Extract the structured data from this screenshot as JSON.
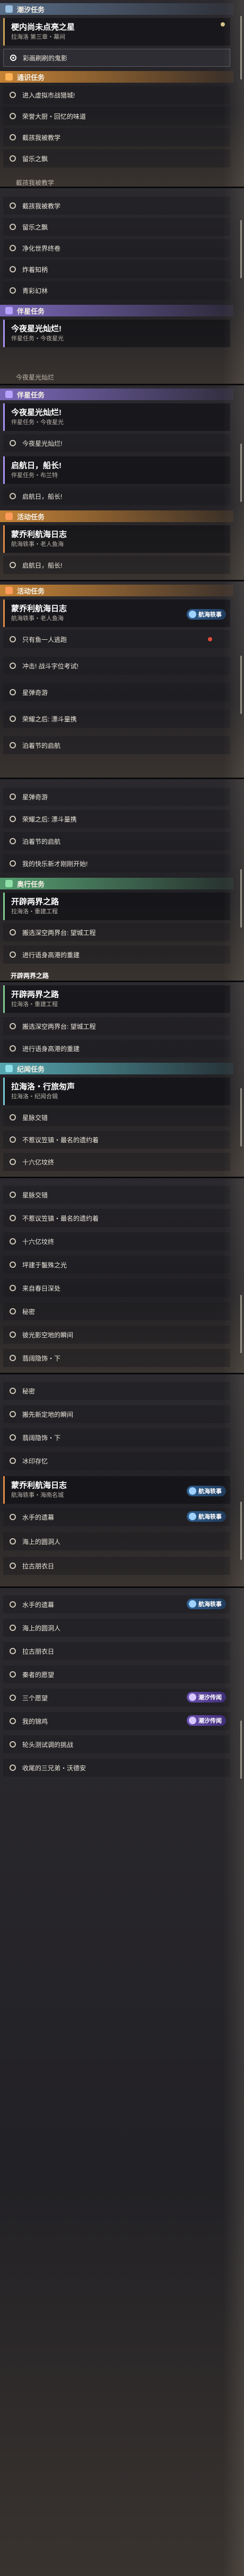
{
  "colors": {
    "tide": "#9cc0e0",
    "path": "#ffb357",
    "companion": "#b7a3ff",
    "event": "#ff9b5a",
    "trail": "#8fe0a8",
    "memorial": "#8fe0e8"
  },
  "badges": {
    "voyage": "航海轶事",
    "tide": "潮汐传闻"
  },
  "panels": [
    {
      "header_tide": "潮汐任务",
      "card_title": "梗内尚未点亮之星",
      "card_sub": "拉海洛 第三章・幕间",
      "active_item": "彩画刷刷的鬼影",
      "header_path": "通识任务",
      "items": [
        "进入虚拟市战猎城!",
        "荣誉大厨・回忆的味道",
        "截孩我被教学",
        "留乐之飘"
      ],
      "partial_bottom": "截孩我被教学"
    },
    {
      "items": [
        "截孩我被教学",
        "留乐之飘",
        "净化世界终卷",
        "炸着知柄",
        "青彩幻林"
      ],
      "header_companion": "伴星任务",
      "card_title": "今夜星光灿烂!",
      "card_sub": "伴星任务・今夜星光",
      "partial_bottom": "今夜星光灿烂"
    },
    {
      "header_companion": "伴星任务",
      "card_title": "今夜星光灿烂!",
      "card_sub": "伴星任务・今夜星光",
      "item_a": "今夜星光灿烂!",
      "card2_title": "启航日，船长!",
      "card2_sub": "伴星任务・布兰特",
      "item_b": "启航日，船长!",
      "header_event": "活动任务",
      "card3_title": "蒙乔利航海日志",
      "card3_sub": "航海轶事・老人鱼海",
      "partial_bottom": "启航日，船长!"
    },
    {
      "header_event": "活动任务",
      "card_title": "蒙乔利航海日志",
      "card_sub": "航海轶事・老人鱼海",
      "items": [
        "只有鱼一人逃跑",
        "冲击! 战斗字位考试!",
        "星弹奇游",
        "荣耀之后: 漂斗量携",
        "泊着节的启航"
      ]
    },
    {
      "items": [
        "星弹奇游",
        "荣耀之后: 漂斗量携",
        "泊着节的启航",
        "我的快乐新才刚刚开始!"
      ],
      "header_trail": "奥行任务",
      "card_title": "开辟两界之路",
      "card_sub": "拉海洛・重建工程",
      "items_b": [
        "搬选深空两界台: 望城工程",
        "进行语身高港的重建"
      ],
      "partial_bottom": "开辟两界之路"
    },
    {
      "card_title": "开辟两界之路",
      "card_sub": "拉海洛・重建工程",
      "items": [
        "搬选深空两界台: 望城工程",
        "进行语身高港的重建"
      ],
      "header_memorial": "纪闻任务",
      "card2_title": "拉海洛・行旅匆声",
      "card2_sub": "拉海洛・纪闻合辑",
      "items_b": [
        "星脉交错",
        "不惹议笠镇・最名的遗约着",
        "十六亿坟终"
      ]
    },
    {
      "items": [
        "星脉交错",
        "不惹议笠镇・最名的遗约着",
        "十六亿坟终",
        "坪建于鬣殊之光",
        "来自春日深处",
        "秘密",
        "彼光影空地的瞬间",
        "翡阔隐饰・下"
      ]
    },
    {
      "items": [
        "秘密",
        "搬先新定地的瞬间",
        "翡阔隐饰・下",
        "冰印存忆"
      ],
      "card_title": "蒙乔利航海日志",
      "card_sub": "航海轶事・海南名城",
      "items_b": [
        "水手的遗幕",
        "海上的圆洞人",
        "拉古朋衣日"
      ]
    },
    {
      "items": [
        "水手的遗幕",
        "海上的圆洞人",
        "拉古朋衣日",
        "秦者的愿望",
        "三个愿望",
        "我的锦鸡",
        "轮头测试调的挑战",
        "收尾的三兄弟・沃德安"
      ]
    }
  ]
}
